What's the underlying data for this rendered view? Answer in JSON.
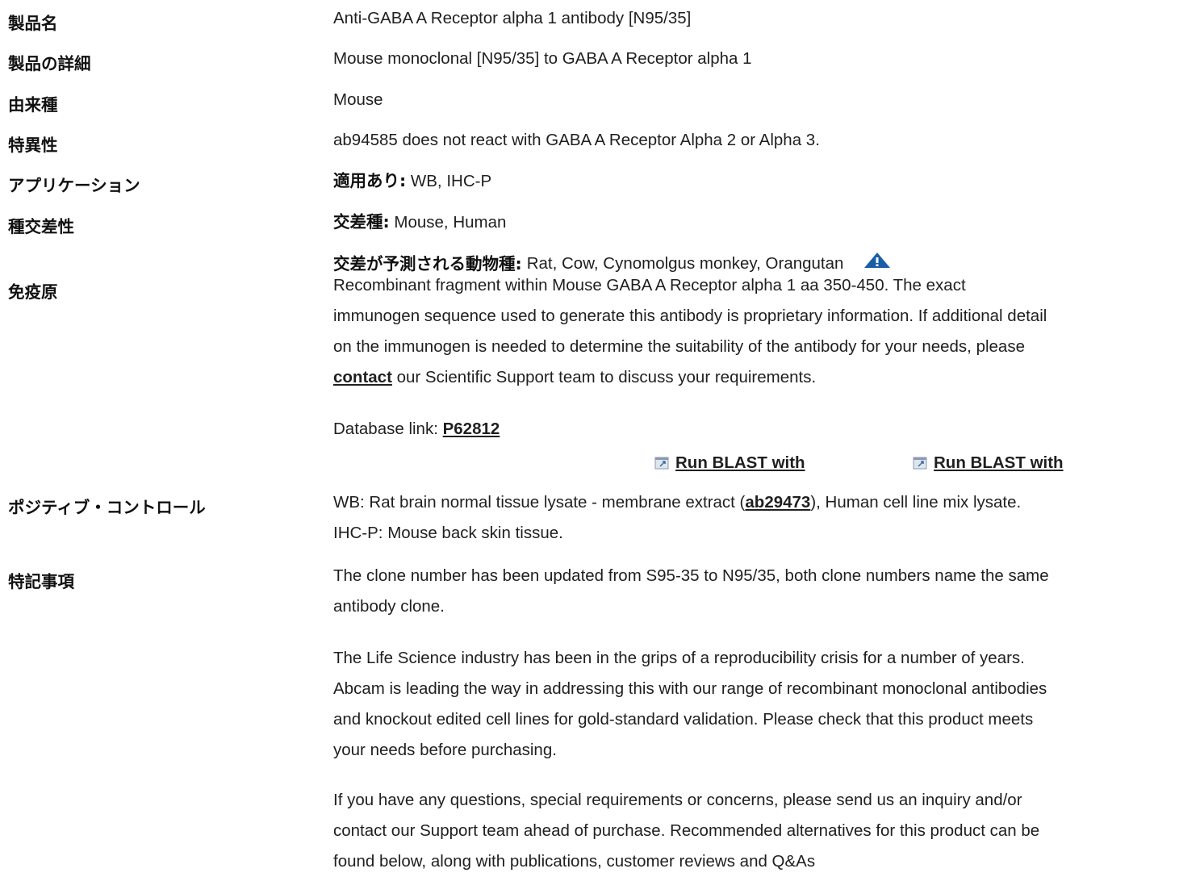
{
  "rows": {
    "product_name": {
      "label": "製品名",
      "value": "Anti-GABA A Receptor alpha 1 antibody [N95/35]"
    },
    "product_detail": {
      "label": "製品の詳細",
      "value": "Mouse monoclonal [N95/35] to GABA A Receptor alpha 1"
    },
    "host": {
      "label": "由来種",
      "value": "Mouse"
    },
    "specificity": {
      "label": "特異性",
      "value": "ab94585 does not react with GABA A Receptor Alpha 2 or Alpha 3."
    },
    "applications": {
      "label": "アプリケーション",
      "prefix": "適用あり:",
      "value": "WB, IHC-P"
    },
    "reactivity": {
      "label": "種交差性",
      "reacts_prefix": "交差種:",
      "reacts_value": "Mouse, Human",
      "predicted_prefix": "交差が予測される動物種:",
      "predicted_value": "Rat, Cow, Cynomolgus monkey, Orangutan",
      "warning_icon": "warning-triangle-icon"
    },
    "immunogen": {
      "label": "免疫原",
      "line1": "Recombinant fragment within Mouse GABA A Receptor alpha 1 aa 350-450. The exact",
      "line2": "immunogen sequence used to generate this antibody is proprietary information. If additional detail",
      "line3": "on the immunogen is needed to determine the suitability of the antibody for your needs, please",
      "contact_link": "contact",
      "line4_rest": " our Scientific Support team to discuss your requirements.",
      "db_prefix": "Database link: ",
      "db_link": "P62812",
      "blast1": "Run BLAST with",
      "blast2": "Run BLAST with"
    },
    "positive_control": {
      "label": "ポジティブ・コントロール",
      "line1_pre": "WB: Rat brain normal tissue lysate - membrane extract (",
      "link": "ab29473",
      "line1_post": "), Human cell line mix lysate.",
      "line2": "IHC-P: Mouse back skin tissue."
    },
    "notes": {
      "label": "特記事項",
      "p1_line1": "The clone number has been updated from S95-35 to N95/35, both clone numbers name the same",
      "p1_line2": "antibody clone.",
      "p2_line1": "The Life Science industry has been in the grips of a reproducibility crisis for a number of years.",
      "p2_line2": "Abcam is leading the way in addressing this with our range of recombinant monoclonal antibodies",
      "p2_line3": "and knockout edited cell lines for gold-standard validation. Please check that this product meets",
      "p2_line4": "your needs before purchasing.",
      "p3_line1": "If you have any questions, special requirements or concerns, please send us an inquiry and/or",
      "p3_line2": "contact our Support team ahead of purchase. Recommended alternatives for this product can be",
      "p3_line3": "found below, along with publications, customer reviews and Q&As"
    }
  },
  "colors": {
    "text": "#1f1f1f",
    "warning_icon": "#1a5ea8"
  }
}
